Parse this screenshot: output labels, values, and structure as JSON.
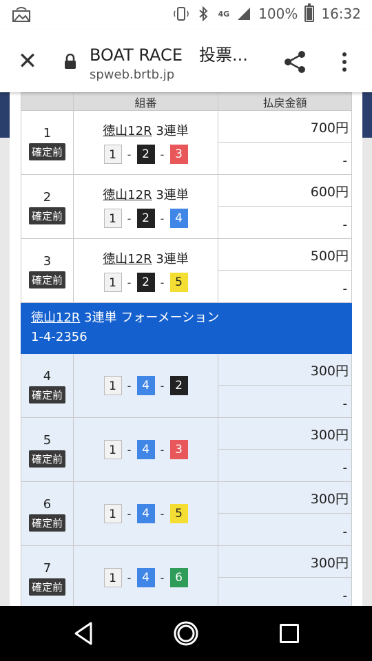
{
  "status_bar": {
    "network": "4G",
    "battery": "100%",
    "time": "16:32"
  },
  "toolbar": {
    "title": "BOAT RACE　投票...",
    "url": "spweb.brtb.jp"
  },
  "table_header": {
    "combo": "組番",
    "payout": "払戻金額"
  },
  "status_label": "確定前",
  "rows_top": [
    {
      "no": "1",
      "race": "徳山12R",
      "type": "3連単",
      "boats": [
        "1",
        "2",
        "3"
      ],
      "payout": "700円",
      "sub": "-"
    },
    {
      "no": "2",
      "race": "徳山12R",
      "type": "3連単",
      "boats": [
        "1",
        "2",
        "4"
      ],
      "payout": "600円",
      "sub": "-"
    },
    {
      "no": "3",
      "race": "徳山12R",
      "type": "3連単",
      "boats": [
        "1",
        "2",
        "5"
      ],
      "payout": "500円",
      "sub": "-"
    }
  ],
  "formation": {
    "race": "徳山12R",
    "title_rest": " 3連単 フォーメーション",
    "combo": "1-4-2356"
  },
  "rows_form": [
    {
      "no": "4",
      "boats": [
        "1",
        "4",
        "2"
      ],
      "payout": "300円",
      "sub": "-"
    },
    {
      "no": "5",
      "boats": [
        "1",
        "4",
        "3"
      ],
      "payout": "300円",
      "sub": "-"
    },
    {
      "no": "6",
      "boats": [
        "1",
        "4",
        "5"
      ],
      "payout": "300円",
      "sub": "-"
    },
    {
      "no": "7",
      "boats": [
        "1",
        "4",
        "6"
      ],
      "payout": "300円",
      "sub": "-"
    }
  ],
  "colors": {
    "formation_blue": "#1560cf",
    "formation_row_bg": "#e6eef9"
  }
}
